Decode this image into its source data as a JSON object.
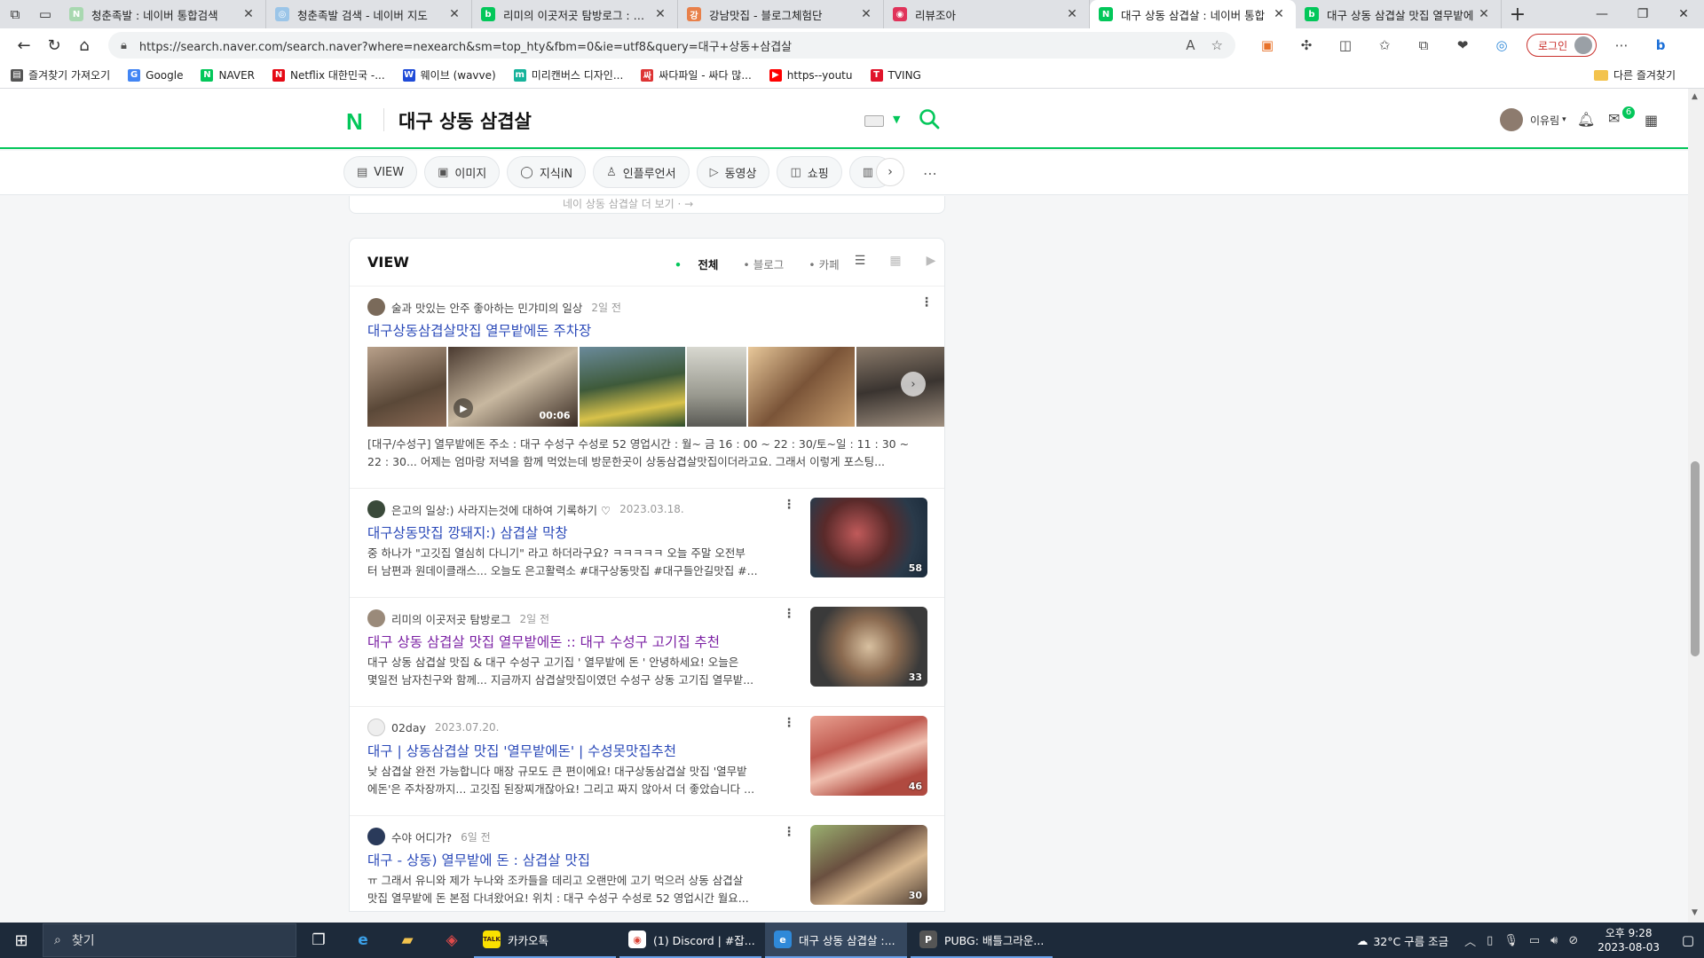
{
  "browser": {
    "tabs": [
      {
        "title": "청춘족발 : 네이버 통합검색",
        "color": "#a8d8b0",
        "fav": "N"
      },
      {
        "title": "청춘족발 검색 - 네이버 지도",
        "color": "#9bc5e8",
        "fav": "◎"
      },
      {
        "title": "리미의 이곳저곳 탐방로그 : 네이",
        "color": "#03c75a",
        "fav": "b"
      },
      {
        "title": "강남맛집 - 블로그체험단",
        "color": "#e8804a",
        "fav": "강"
      },
      {
        "title": "리뷰조아",
        "color": "#e0335a",
        "fav": "◉"
      },
      {
        "title": "대구 상동 삼겹살 : 네이버 통합",
        "color": "#03c75a",
        "fav": "N"
      },
      {
        "title": "대구 상동 삼겹살 맛집 열무밭에",
        "color": "#03c75a",
        "fav": "b"
      }
    ],
    "url": "https://search.naver.com/search.naver?where=nexearch&sm=top_hty&fbm=0&ie=utf8&query=대구+상동+삼겹살",
    "login_label": "로그인",
    "bookmarks": [
      {
        "label": "즐겨찾기 가져오기",
        "color": "#555",
        "fav": "▤"
      },
      {
        "label": "Google",
        "color": "#4285f4",
        "fav": "G"
      },
      {
        "label": "NAVER",
        "color": "#03c75a",
        "fav": "N"
      },
      {
        "label": "Netflix 대한민국 -...",
        "color": "#e50914",
        "fav": "N"
      },
      {
        "label": "웨이브 (wavve)",
        "color": "#1f4bd8",
        "fav": "W"
      },
      {
        "label": "미리캔버스 디자인...",
        "color": "#16b39b",
        "fav": "m"
      },
      {
        "label": "싸다파일 - 싸다 많...",
        "color": "#d33",
        "fav": "싸"
      },
      {
        "label": "https--youtu",
        "color": "#ff0000",
        "fav": "▶"
      },
      {
        "label": "TVING",
        "color": "#e0142b",
        "fav": "T"
      }
    ],
    "other_bookmarks": "다른 즐겨찾기"
  },
  "naver": {
    "logo": "N",
    "query": "대구 상동 삼겹살",
    "user_name": "이유림",
    "mail_count": "6",
    "nav_chips": [
      {
        "label": "VIEW",
        "icon": "▤"
      },
      {
        "label": "이미지",
        "icon": "▣"
      },
      {
        "label": "지식iN",
        "icon": "◯"
      },
      {
        "label": "인플루언서",
        "icon": "♙"
      },
      {
        "label": "동영상",
        "icon": "▷"
      },
      {
        "label": "쇼핑",
        "icon": "◫"
      },
      {
        "label": "",
        "icon": "▥"
      }
    ],
    "prev_card_text": "네이 상동 삼겹살 더 보기 ·  →"
  },
  "view_section": {
    "title": "VIEW",
    "filters": [
      "전체",
      "블로그",
      "카페"
    ],
    "items": [
      {
        "author": "술과 맛있는 안주 좋아하는 민갸미의 일상",
        "date": "2일 전",
        "title": "대구상동삼겹살맛집 열무밭에돈 주차장",
        "video_duration": "00:06",
        "desc_line1": "[대구/수성구] 열무밭에돈 주소 : 대구 수성구 수성로 52 영업시간 : 월~ 금 16 : 00 ~ 22 : 30/토~일 : 11 : 30 ~",
        "desc_line2": "22 : 30... 어제는 엄마랑 저녁을 함께 먹었는데 방문한곳이 상동삼겹살맛집이더라고요. 그래서 이렇게 포스팅..."
      },
      {
        "author": "은고의 일상:) 사라지는것에 대하여 기록하기 ♡",
        "date": "2023.03.18.",
        "title": "대구상동맛집 깡돼지:) 삼겹살 막창",
        "count": "58",
        "desc_line1": "중 하나가 \"고깃집 열심히 다니기\" 라고 하더라구요? ㅋㅋㅋㅋㅋ 오늘 주말 오전부",
        "desc_line2": "터 남편과 원데이클래스... 오늘도 은고활력소 #대구상동맛집 #대구들안길맛집 #..."
      },
      {
        "author": "리미의 이곳저곳 탐방로그",
        "date": "2일 전",
        "title": "대구 상동 삼겹살 맛집 열무밭에돈 :: 대구 수성구 고기집 추천",
        "count": "33",
        "desc_line1": "대구 상동 삼겹살 맛집 & 대구 수성구 고기집 ' 열무밭에 돈 ' 안녕하세요! 오늘은",
        "desc_line2": "몇일전 남자친구와 함께... 지금까지 삼겹살맛집이였던 수성구 상동 고기집 열무밭..."
      },
      {
        "author": "02day",
        "date": "2023.07.20.",
        "title": "대구 | 상동삼겹살 맛집 '열무밭에돈' | 수성못맛집추천",
        "count": "46",
        "desc_line1": "낮 삼겹살 완전 가능합니다 매장 규모도 큰 편이에요! 대구상동삼겹살 맛집 '열무밭",
        "desc_line2": "에돈'은 주차장까지... 고깃집 된장찌개잖아요! 그리고 짜지 않아서 더 좋았습니다 ..."
      },
      {
        "author": "수야 어디가?",
        "date": "6일 전",
        "title": "대구 - 상동) 열무밭에 돈 : 삼겹살 맛집",
        "count": "30",
        "desc_line1": "ㅠ 그래서 유니와 제가 누나와 조카들을 데리고 오랜만에 고기 먹으러 상동 삼겹살",
        "desc_line2": "맛집 열무밭에 돈 본점 다녀왔어요! 위치 : 대구 수성구 수성로 52 영업시간 월요..."
      }
    ]
  },
  "taskbar": {
    "search_placeholder": "찾기",
    "apps": [
      {
        "label": "카카오톡",
        "color": "#fae100",
        "fav": "TALK",
        "fg": "#3a1d1d"
      },
      {
        "label": "(1) Discord | #잡...",
        "color": "#ffffff",
        "fav": "◉",
        "fg": "#db4437"
      },
      {
        "label": "대구 상동 삼겹살 :...",
        "color": "#2f89d9",
        "fav": "e",
        "fg": "#fff"
      },
      {
        "label": "PUBG: 배틀그라운...",
        "color": "#555",
        "fav": "P",
        "fg": "#fff"
      }
    ],
    "weather": "32°C  구름 조금",
    "time": "오후 9:28",
    "date": "2023-08-03"
  }
}
